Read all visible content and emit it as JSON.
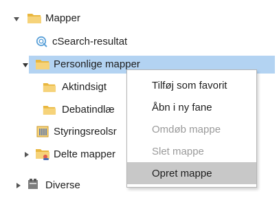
{
  "tree": {
    "root_label": "Mapper",
    "search_results_label": "cSearch-resultat",
    "personal_label": "Personlige mapper",
    "aktindsigt_label": "Aktindsigt",
    "debat_label": "Debatindlæ",
    "styring_label": "Styringsreolsr",
    "shared_label": "Delte mapper",
    "misc_label": "Diverse"
  },
  "context_menu": {
    "items": [
      {
        "label": "Tilføj som favorit",
        "enabled": true
      },
      {
        "label": "Åbn i ny fane",
        "enabled": true
      },
      {
        "label": "Omdøb mappe",
        "enabled": false
      },
      {
        "label": "Slet mappe",
        "enabled": false
      },
      {
        "label": "Opret mappe",
        "enabled": true,
        "hovered": true
      }
    ]
  },
  "colors": {
    "selection": "#b3d3f2",
    "folder": "#f2c94c",
    "menu_hover": "#c8c8c8",
    "disabled_text": "#9a9a9a"
  },
  "icons": {
    "root": "folder-icon",
    "search": "search-icon",
    "folder": "folder-icon",
    "shelf": "shelf-icon",
    "shared": "shared-folder-icon",
    "misc": "misc-icon"
  }
}
